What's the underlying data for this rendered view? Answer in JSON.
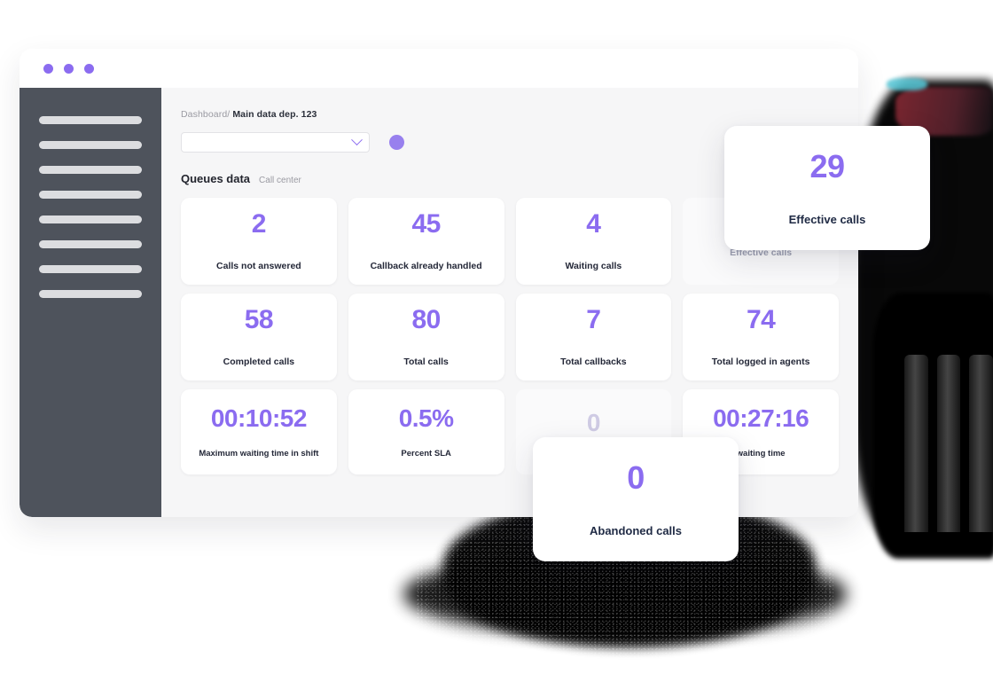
{
  "window": {
    "traffic_lights": [
      "dot-1",
      "dot-2",
      "dot-3"
    ],
    "accent_color": "#8b6cf0",
    "sidebar_color": "#4e535c",
    "content_bg": "#f6f6f7",
    "label_color": "#242838"
  },
  "sidebar": {
    "items": [
      {
        "name": "nav-placeholder-1"
      },
      {
        "name": "nav-placeholder-2"
      },
      {
        "name": "nav-placeholder-3"
      },
      {
        "name": "nav-placeholder-4"
      },
      {
        "name": "nav-placeholder-5"
      },
      {
        "name": "nav-placeholder-6"
      },
      {
        "name": "nav-placeholder-7"
      },
      {
        "name": "nav-placeholder-8"
      }
    ]
  },
  "breadcrumb": {
    "root": "Dashboard/",
    "current": "Main data dep. 123"
  },
  "toolbar": {
    "select_value": "",
    "select_placeholder": "",
    "chevron_icon": "chevron-down-icon",
    "avatar_icon": "avatar-circle-icon"
  },
  "section": {
    "title": "Queues data",
    "subtitle": "Call center"
  },
  "cards": {
    "row1": [
      {
        "value": "2",
        "label": "Calls not answered",
        "dim": false
      },
      {
        "value": "45",
        "label": "Callback already handled",
        "dim": false
      },
      {
        "value": "4",
        "label": "Waiting calls",
        "dim": false
      },
      {
        "value": "",
        "label": "Effective calls",
        "dim": true
      }
    ],
    "row2": [
      {
        "value": "58",
        "label": "Completed calls",
        "dim": false
      },
      {
        "value": "80",
        "label": "Total calls",
        "dim": false
      },
      {
        "value": "7",
        "label": "Total callbacks",
        "dim": false
      },
      {
        "value": "74",
        "label": "Total logged in agents",
        "dim": false
      }
    ],
    "row3": [
      {
        "value": "00:10:52",
        "label": "Maximum waiting time in shift",
        "dim": false
      },
      {
        "value": "0.5%",
        "label": "Percent SLA",
        "dim": false
      },
      {
        "value": "0",
        "label": "",
        "dim": true
      },
      {
        "value": "00:27:16",
        "label": "waiting time",
        "dim": false
      }
    ]
  },
  "popups": [
    {
      "value": "29",
      "label": "Effective calls"
    },
    {
      "value": "0",
      "label": "Abandoned calls"
    }
  ]
}
